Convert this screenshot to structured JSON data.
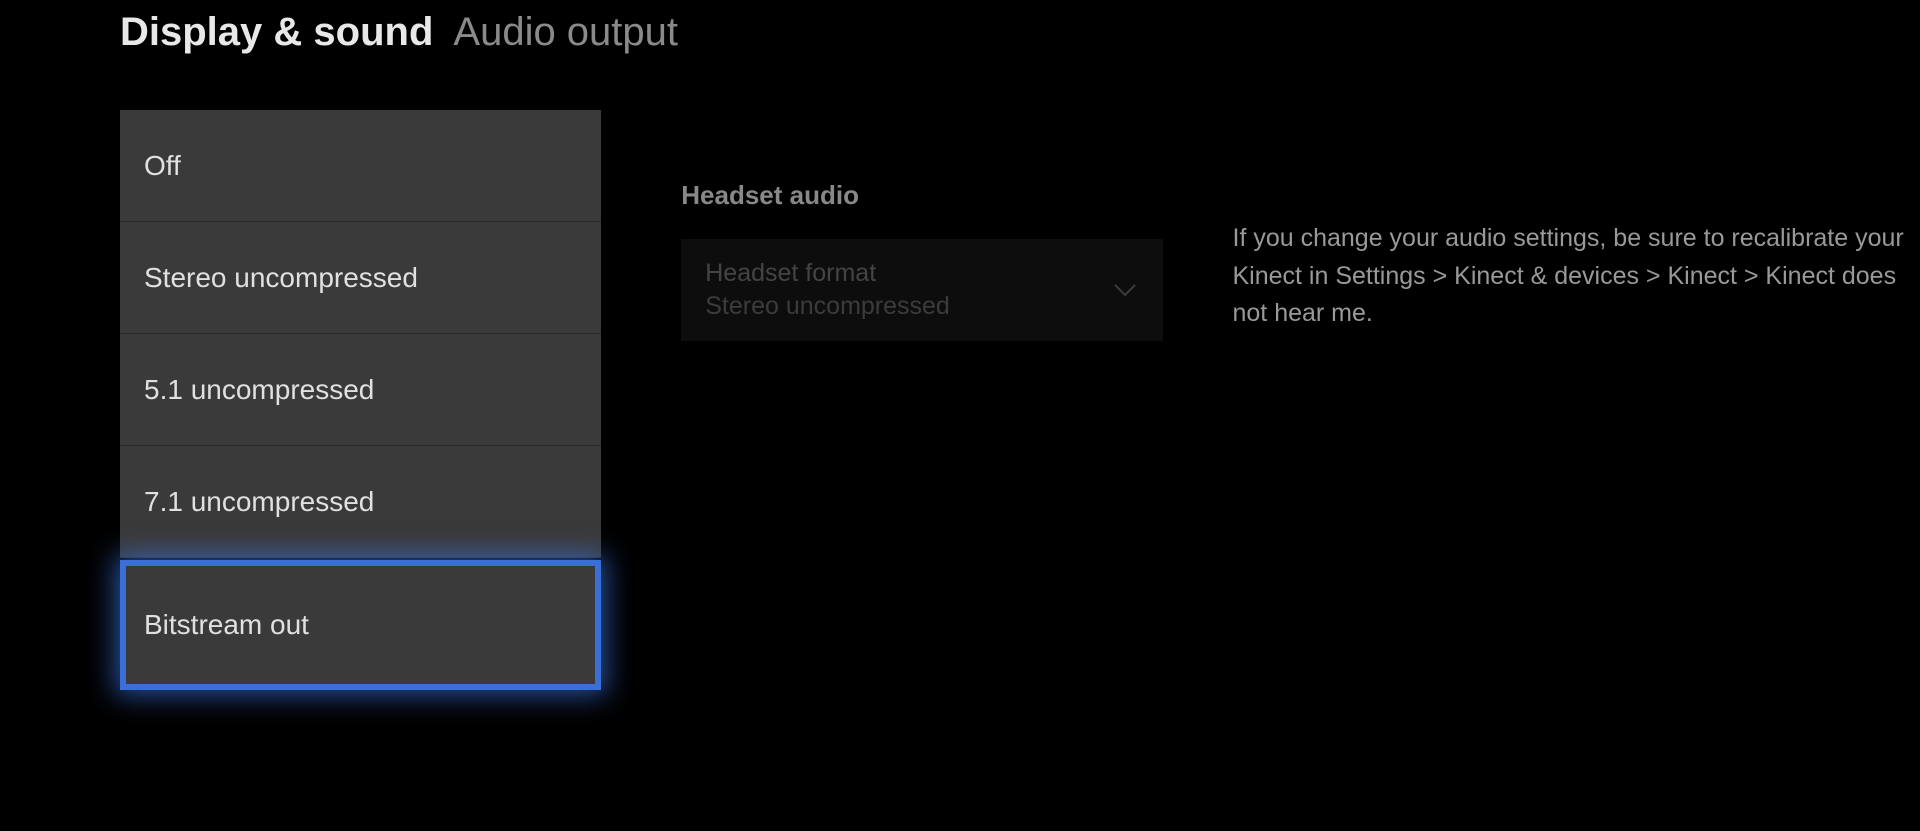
{
  "header": {
    "title": "Display & sound",
    "subtitle": "Audio output"
  },
  "options": {
    "items": [
      {
        "label": "Off",
        "selected": false
      },
      {
        "label": "Stereo uncompressed",
        "selected": false
      },
      {
        "label": "5.1 uncompressed",
        "selected": false
      },
      {
        "label": "7.1 uncompressed",
        "selected": false
      },
      {
        "label": "Bitstream out",
        "selected": true
      }
    ]
  },
  "headset": {
    "section_label": "Headset audio",
    "dropdown_label": "Headset format",
    "dropdown_value": "Stereo uncompressed"
  },
  "info": {
    "text": "If you change your audio settings, be sure to recalibrate your Kinect in Settings > Kinect & devices > Kinect > Kinect does not hear me."
  }
}
